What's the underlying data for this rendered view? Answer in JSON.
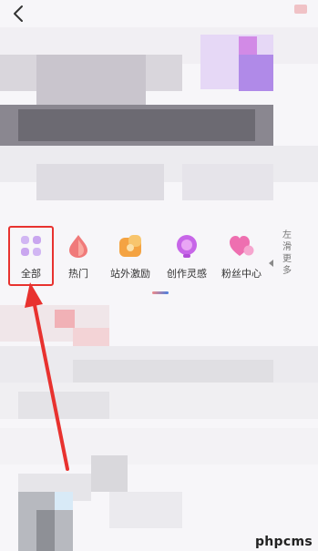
{
  "header": {
    "back_icon": "chevron-left-icon"
  },
  "categories": [
    {
      "label": "全部",
      "icon": "grid-icon",
      "color": "#c9a6ef",
      "selected": true
    },
    {
      "label": "热门",
      "icon": "drop-icon",
      "color": "#f07a7a"
    },
    {
      "label": "站外激励",
      "icon": "gift-icon",
      "color": "#f4a342"
    },
    {
      "label": "创作灵感",
      "icon": "bulb-icon",
      "color": "#c766e8"
    },
    {
      "label": "粉丝中心",
      "icon": "hearts-icon",
      "color": "#ee6fb0"
    }
  ],
  "swipe_hint": "左滑更多",
  "annotation": {
    "highlight_color": "#e8322f"
  },
  "watermark": "phpcms"
}
